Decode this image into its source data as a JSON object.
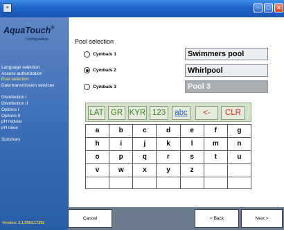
{
  "titlebar": {
    "icon": "app-window-icon",
    "controls": [
      "minimize-icon",
      "maximize-icon",
      "close-icon"
    ]
  },
  "sidebar": {
    "logo": "AquaTouch",
    "logo_mark": "®",
    "logo_sub": "Configuration",
    "items": [
      "Language selection",
      "Access authorization",
      "Pool selection",
      "Data transmission services",
      "",
      "Disinfection I",
      "Disinfection II",
      "Options I",
      "Options II",
      "pH reduce",
      "pH raise",
      "",
      "Summary"
    ],
    "active_item": "Pool selection",
    "version": "Version: 2.1.5991.17251"
  },
  "main": {
    "title": "Pool selection",
    "symbol_sets": [
      {
        "label": "Cymbals 1",
        "checked": false
      },
      {
        "label": "Cymbals 2",
        "checked": true
      },
      {
        "label": "Cymbals 3",
        "checked": false
      }
    ],
    "pools": [
      {
        "name": "Swimmers pool",
        "enabled": true
      },
      {
        "name": "Whirlpool",
        "enabled": true
      },
      {
        "name": "Pool 3",
        "enabled": false
      }
    ],
    "keyboard": {
      "mode_keys": [
        "LAT",
        "GR",
        "KYR",
        "123",
        "abc",
        "<-",
        "CLR"
      ],
      "rows": [
        [
          "a",
          "b",
          "c",
          "d",
          "e",
          "f",
          "g"
        ],
        [
          "h",
          "i",
          "j",
          "k",
          "l",
          "m",
          "n"
        ],
        [
          "o",
          "p",
          "q",
          "r",
          "s",
          "t",
          "u"
        ],
        [
          "v",
          "w",
          "x",
          "y",
          "z",
          "",
          ""
        ],
        [
          "",
          "",
          "",
          "",
          "",
          "",
          ""
        ]
      ]
    }
  },
  "footer": {
    "cancel": "Cancel",
    "back": "< Back",
    "next": "Next >"
  },
  "colors": {
    "background_blue": "#2f5fa6",
    "sidebar_text": "#ffffff",
    "version_text": "#f2d24a",
    "mode_key_green": "#3d7a2a",
    "mode_key_red": "#d12a2a",
    "footer_gray": "#6b7c90"
  }
}
